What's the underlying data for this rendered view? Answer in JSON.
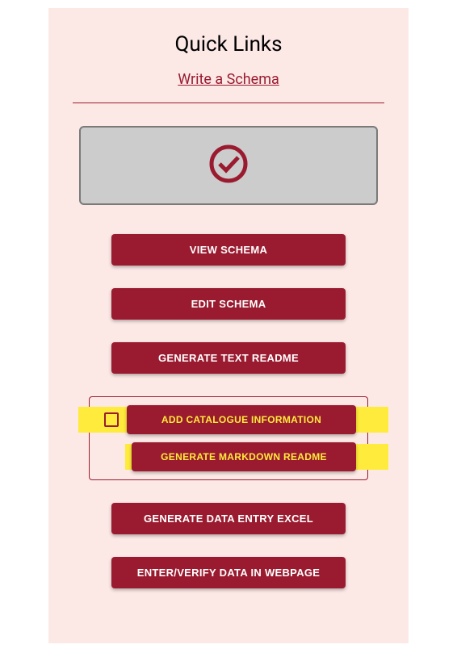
{
  "title": "Quick Links",
  "subtitle_link": "Write a Schema",
  "buttons": {
    "view_schema": "VIEW SCHEMA",
    "edit_schema": "EDIT SCHEMA",
    "generate_text_readme": "GENERATE TEXT README",
    "add_catalogue": "ADD CATALOGUE INFORMATION",
    "generate_markdown": "GENERATE MARKDOWN README",
    "generate_excel": "GENERATE DATA ENTRY EXCEL",
    "enter_verify": "ENTER/VERIFY DATA IN WEBPAGE"
  },
  "colors": {
    "accent": "#9a1b30",
    "highlight": "#ffeb3b",
    "panel_bg": "#fce9e6"
  }
}
